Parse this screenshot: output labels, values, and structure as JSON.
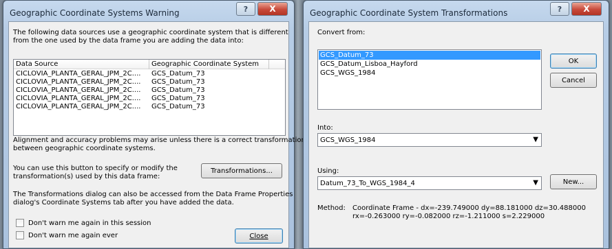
{
  "left_dialog": {
    "title": "Geographic Coordinate Systems Warning",
    "help_icon": "?",
    "close_icon": "X",
    "intro_line1": "The following data sources use a geographic coordinate system that is different",
    "intro_line2": "from the one used by the data frame you are adding the data into:",
    "table": {
      "headers": [
        "Data Source",
        "Geographic Coordinate System"
      ],
      "rows": [
        [
          "CICLOVIA_PLANTA_GERAL_JPM_2C....",
          "GCS_Datum_73"
        ],
        [
          "CICLOVIA_PLANTA_GERAL_JPM_2C....",
          "GCS_Datum_73"
        ],
        [
          "CICLOVIA_PLANTA_GERAL_JPM_2C....",
          "GCS_Datum_73"
        ],
        [
          "CICLOVIA_PLANTA_GERAL_JPM_2C....",
          "GCS_Datum_73"
        ],
        [
          "CICLOVIA_PLANTA_GERAL_JPM_2C....",
          "GCS_Datum_73"
        ]
      ]
    },
    "align_line1": "Alignment and accuracy problems may arise unless there is a correct transformation",
    "align_line2": "between geographic coordinate systems.",
    "use_line1": "You can use this button to specify or modify the",
    "use_line2": "transformation(s) used by this data frame:",
    "transformations_button": "Transformations...",
    "also_line1": "The Transformations dialog can also be accessed from the Data Frame Properties",
    "also_line2": "dialog's Coordinate Systems tab after you have added the data.",
    "checkbox_session": "Don't warn me again in this session",
    "checkbox_ever": "Don't warn me again ever",
    "close_button": "Close"
  },
  "right_dialog": {
    "title": "Geographic Coordinate System Transformations",
    "help_icon": "?",
    "close_icon": "X",
    "convert_from_label": "Convert from:",
    "convert_from_items": [
      {
        "label": "GCS_Datum_73",
        "selected": true
      },
      {
        "label": "GCS_Datum_Lisboa_Hayford",
        "selected": false
      },
      {
        "label": "GCS_WGS_1984",
        "selected": false
      }
    ],
    "ok_button": "OK",
    "cancel_button": "Cancel",
    "into_label": "Into:",
    "into_value": "GCS_WGS_1984",
    "using_label": "Using:",
    "using_value": "Datum_73_To_WGS_1984_4",
    "new_button": "New...",
    "method_label": "Method:",
    "method_line1": "Coordinate Frame - dx=-239.749000 dy=88.181000 dz=30.488000",
    "method_line2": "rx=-0.263000 ry=-0.082000 rz=-1.211000 s=2.229000"
  },
  "colors": {
    "selection": "#3399ff",
    "title_bar": "#b7cde6",
    "close_button": "#c8493a"
  }
}
